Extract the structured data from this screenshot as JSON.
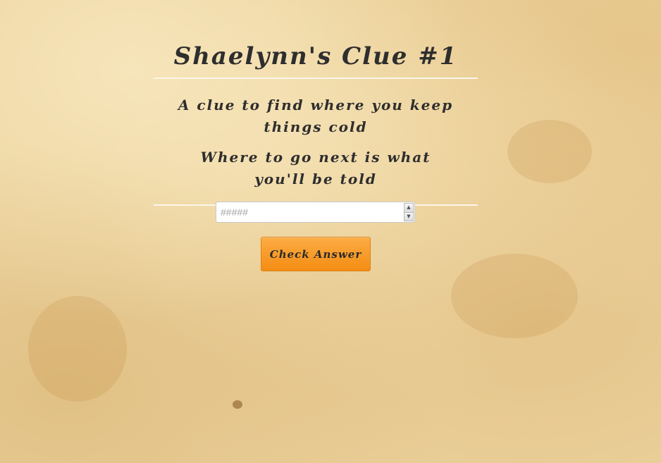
{
  "page": {
    "title": "Shaelynn's Clue #1"
  },
  "clue": {
    "line1": "A clue to find where you keep things cold",
    "line2": "Where to go next is what you'll be told"
  },
  "answer": {
    "value": "",
    "placeholder": "#####"
  },
  "check_button": {
    "label": "Check Answer"
  },
  "colors": {
    "parchment": "#ecd29d",
    "button_top": "#fcac45",
    "button_bottom": "#f48d13",
    "text": "#2e2e2e"
  },
  "icons": {
    "spinner_up": "triangle-up",
    "spinner_down": "triangle-down"
  }
}
